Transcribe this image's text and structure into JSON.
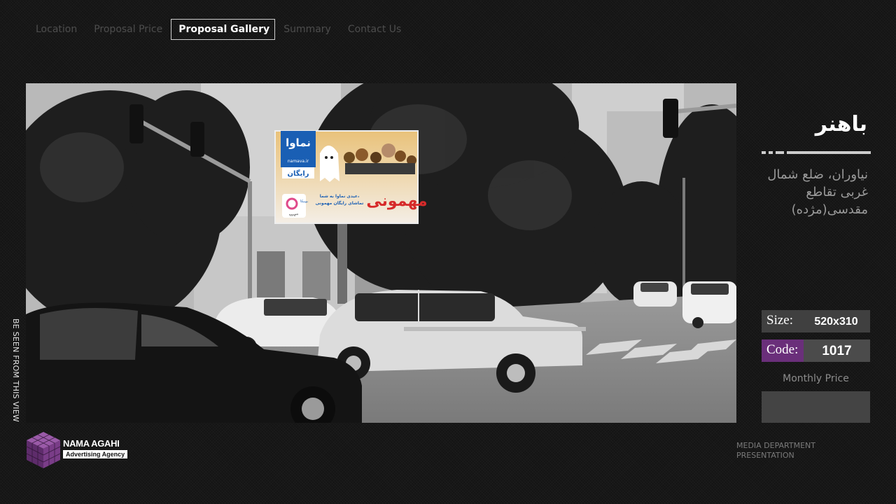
{
  "nav": {
    "items": [
      "Location",
      "Proposal Price",
      "Proposal Gallery",
      "Summary",
      "Contact Us"
    ],
    "active_index": 2
  },
  "photo": {
    "caption": "BE SEEN FROM THIS VIEW",
    "billboard": {
      "brand": "نماوا",
      "brand_url": "namava.ir",
      "free_label": "رایگان",
      "show_title": "مهمونی",
      "slogan_line1": "عیدی نماوا به شما،",
      "slogan_line2": "تماشای رایگان مهمونی",
      "partner": "بوبیکا",
      "phone": "۹۹۹۳*"
    }
  },
  "panel": {
    "title": "باهنر",
    "address": "نیاوران، ضلع شمال غربی تقاطع مقدسی(مژده)",
    "size_label": "Size:",
    "size_value": "520x310",
    "code_label": "Code:",
    "code_value": "1017",
    "monthly_price_label": "Monthly Price",
    "monthly_price_value": ""
  },
  "footer": {
    "brand_name": "NAMA AGAHI",
    "brand_subtitle": "Advertising Agency",
    "department": "MEDIA DEPARTMENT PRESENTATION"
  },
  "colors": {
    "background": "#141414",
    "accent_purple": "#6a2f7a",
    "box_gray": "#4a4a4a",
    "nav_inactive": "#4d4d4d",
    "billboard_blue": "#1a5fb4",
    "billboard_red": "#d62a2a"
  },
  "icons": {
    "logo": "purple-cube-icon",
    "billboard_logo": "namava-logo-icon"
  }
}
